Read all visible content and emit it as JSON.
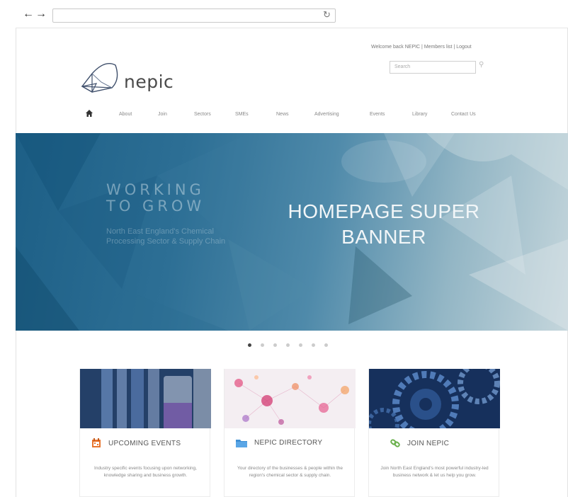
{
  "browser": {
    "back_icon": "arrow-left-icon",
    "forward_icon": "arrow-right-icon",
    "reload_icon": "reload-icon",
    "url": ""
  },
  "header": {
    "topline": "Welcome back NEPIC | Members list | Logout",
    "search_placeholder": "Search",
    "logo_text": "nepic"
  },
  "nav": {
    "items": [
      "About",
      "Join",
      "Sectors",
      "SMEs",
      "News",
      "Advertising",
      "Events",
      "Library",
      "Contact Us"
    ]
  },
  "banner": {
    "tagline_1": "WORKING",
    "tagline_2": "TO GROW",
    "subtitle": "North East England's Chemical Processing Sector & Supply Chain",
    "title_1": "HOMEPAGE SUPER",
    "title_2": "BANNER",
    "slide_count": 7,
    "active_slide": 1
  },
  "cards": [
    {
      "title": "UPCOMING EVENTS",
      "icon": "calendar-icon",
      "icon_color": "#e8742d",
      "text": "Industry specific events focusing upon networking, knowledge sharing and business growth."
    },
    {
      "title": "NEPIC DIRECTORY",
      "icon": "folder-icon",
      "icon_color": "#3f8fd4",
      "text": "Your directory of the businesses & people within the region's chemical sector & supply chain."
    },
    {
      "title": "JOIN NEPIC",
      "icon": "link-icon",
      "icon_color": "#6ab04c",
      "text": "Join North East England's most powerful industry-led business network & let us help you grow."
    }
  ],
  "colors": {
    "banner_dark": "#1d5f86",
    "banner_light": "#c5d6dc",
    "text": "#555555"
  }
}
